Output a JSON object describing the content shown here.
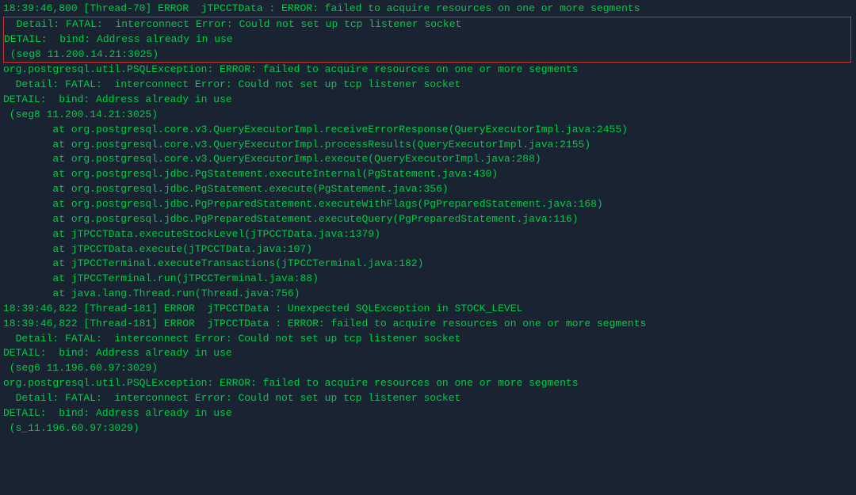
{
  "terminal": {
    "lines": [
      {
        "id": "line1",
        "text": "18:39:46,800 [Thread-70] ERROR  jTPCCTData : ERROR: failed to acquire resources on one or more segments",
        "highlighted": false
      },
      {
        "id": "line2",
        "text": "  Detail: FATAL:  interconnect Error: Could not set up tcp listener socket",
        "highlighted": true
      },
      {
        "id": "line3",
        "text": "DETAIL:  bind: Address already in use",
        "highlighted": true
      },
      {
        "id": "line4",
        "text": " (seg8 11.200.14.21:3025)",
        "highlighted": true
      },
      {
        "id": "line5",
        "text": "org.postgresql.util.PSQLException: ERROR: failed to acquire resources on one or more segments",
        "highlighted": false
      },
      {
        "id": "line6",
        "text": "  Detail: FATAL:  interconnect Error: Could not set up tcp listener socket",
        "highlighted": false
      },
      {
        "id": "line7",
        "text": "DETAIL:  bind: Address already in use",
        "highlighted": false
      },
      {
        "id": "line8",
        "text": " (seg8 11.200.14.21:3025)",
        "highlighted": false
      },
      {
        "id": "line9",
        "text": "        at org.postgresql.core.v3.QueryExecutorImpl.receiveErrorResponse(QueryExecutorImpl.java:2455)",
        "highlighted": false
      },
      {
        "id": "line10",
        "text": "        at org.postgresql.core.v3.QueryExecutorImpl.processResults(QueryExecutorImpl.java:2155)",
        "highlighted": false
      },
      {
        "id": "line11",
        "text": "        at org.postgresql.core.v3.QueryExecutorImpl.execute(QueryExecutorImpl.java:288)",
        "highlighted": false
      },
      {
        "id": "line12",
        "text": "        at org.postgresql.jdbc.PgStatement.executeInternal(PgStatement.java:430)",
        "highlighted": false
      },
      {
        "id": "line13",
        "text": "        at org.postgresql.jdbc.PgStatement.execute(PgStatement.java:356)",
        "highlighted": false
      },
      {
        "id": "line14",
        "text": "        at org.postgresql.jdbc.PgPreparedStatement.executeWithFlags(PgPreparedStatement.java:168)",
        "highlighted": false
      },
      {
        "id": "line15",
        "text": "        at org.postgresql.jdbc.PgPreparedStatement.executeQuery(PgPreparedStatement.java:116)",
        "highlighted": false
      },
      {
        "id": "line16",
        "text": "        at jTPCCTData.executeStockLevel(jTPCCTData.java:1379)",
        "highlighted": false
      },
      {
        "id": "line17",
        "text": "        at jTPCCTData.execute(jTPCCTData.java:107)",
        "highlighted": false
      },
      {
        "id": "line18",
        "text": "        at jTPCCTerminal.executeTransactions(jTPCCTerminal.java:182)",
        "highlighted": false
      },
      {
        "id": "line19",
        "text": "        at jTPCCTerminal.run(jTPCCTerminal.java:88)",
        "highlighted": false
      },
      {
        "id": "line20",
        "text": "        at java.lang.Thread.run(Thread.java:756)",
        "highlighted": false
      },
      {
        "id": "line21",
        "text": "18:39:46,822 [Thread-181] ERROR  jTPCCTData : Unexpected SQLException in STOCK_LEVEL",
        "highlighted": false
      },
      {
        "id": "line22",
        "text": "18:39:46,822 [Thread-181] ERROR  jTPCCTData : ERROR: failed to acquire resources on one or more segments",
        "highlighted": false
      },
      {
        "id": "line23",
        "text": "  Detail: FATAL:  interconnect Error: Could not set up tcp listener socket",
        "highlighted": false
      },
      {
        "id": "line24",
        "text": "DETAIL:  bind: Address already in use",
        "highlighted": false
      },
      {
        "id": "line25",
        "text": " (seg6 11.196.60.97:3029)",
        "highlighted": false
      },
      {
        "id": "line26",
        "text": "org.postgresql.util.PSQLException: ERROR: failed to acquire resources on one or more segments",
        "highlighted": false
      },
      {
        "id": "line27",
        "text": "  Detail: FATAL:  interconnect Error: Could not set up tcp listener socket",
        "highlighted": false
      },
      {
        "id": "line28",
        "text": "DETAIL:  bind: Address already in use",
        "highlighted": false
      },
      {
        "id": "line29",
        "text": " (s_11.196.60.97:3029)",
        "highlighted": false
      }
    ]
  }
}
